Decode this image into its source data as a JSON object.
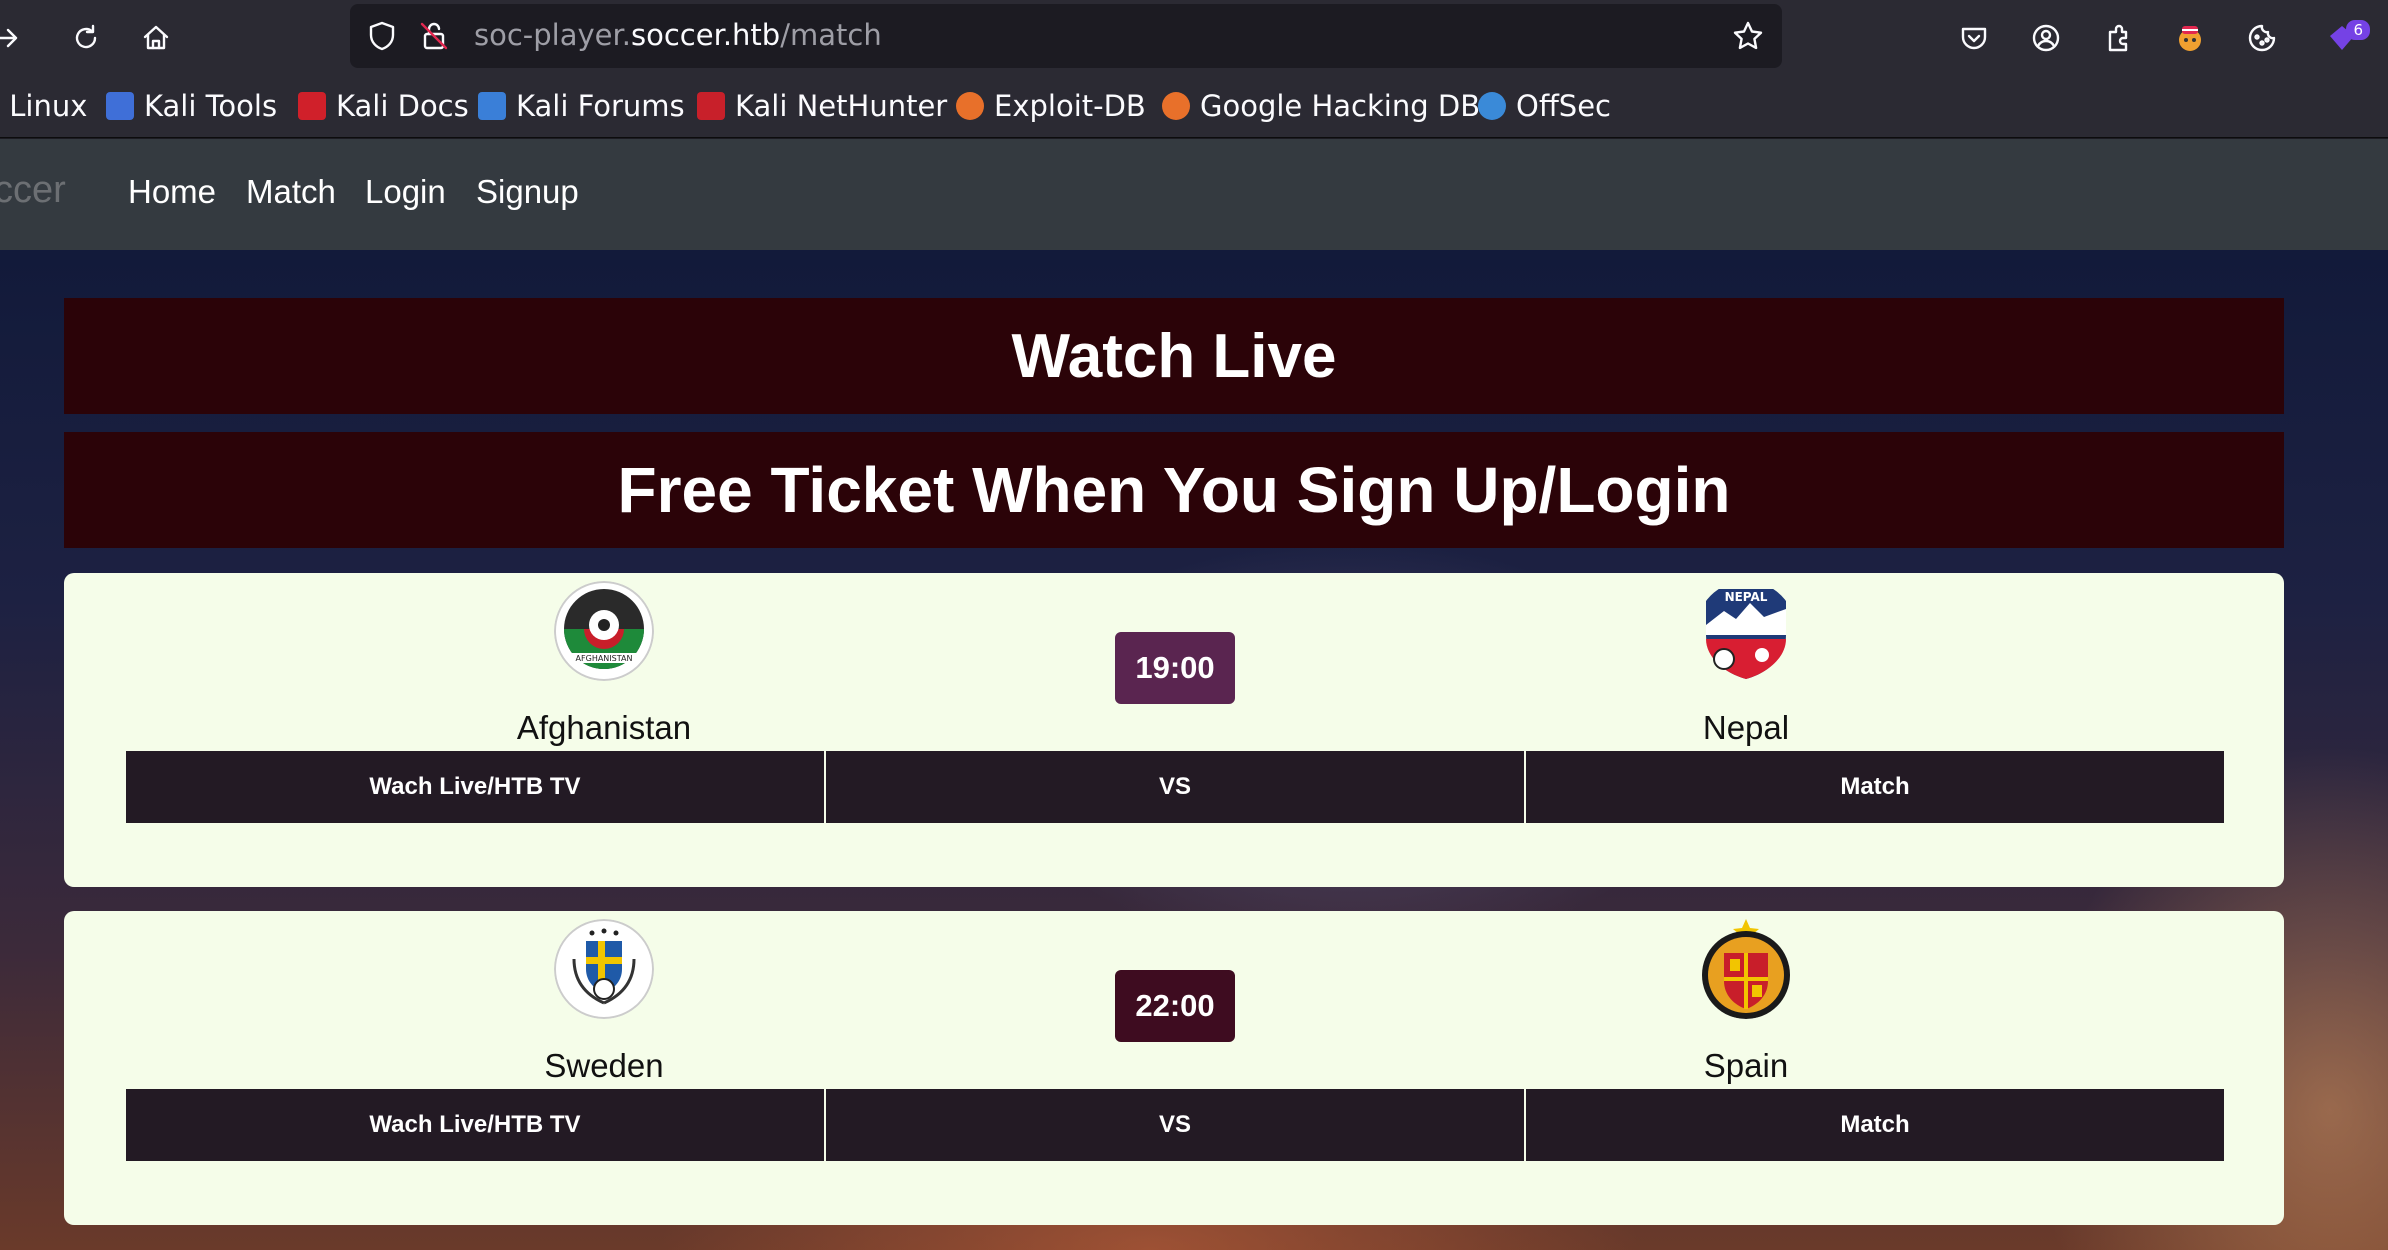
{
  "browser": {
    "url_prefix": "soc-player.",
    "url_domain": "soccer.htb",
    "url_path": "/match",
    "extension_badge": "6",
    "bookmarks": [
      {
        "label": "i Linux",
        "color": ""
      },
      {
        "label": "Kali Tools",
        "color": "#3f6fd8"
      },
      {
        "label": "Kali Docs",
        "color": "#d0202a"
      },
      {
        "label": "Kali Forums",
        "color": "#3a7fd8"
      },
      {
        "label": "Kali NetHunter",
        "color": "#c8202a"
      },
      {
        "label": "Exploit-DB",
        "color": "#e8702a"
      },
      {
        "label": "Google Hacking DB",
        "color": "#e8702a"
      },
      {
        "label": "OffSec",
        "color": "#3a8ad8"
      }
    ]
  },
  "site": {
    "brand": "ccer",
    "nav": [
      "Home",
      "Match",
      "Login",
      "Signup"
    ],
    "banner_primary": "Watch Live",
    "banner_secondary": "Free Ticket When You Sign Up/Login"
  },
  "matches": [
    {
      "home": "Afghanistan",
      "away": "Nepal",
      "time": "19:00",
      "time_color": "#5a2550",
      "actions": [
        "Wach Live/HTB TV",
        "VS",
        "Match"
      ]
    },
    {
      "home": "Sweden",
      "away": "Spain",
      "time": "22:00",
      "time_color": "#3e0c20",
      "actions": [
        "Wach Live/HTB TV",
        "VS",
        "Match"
      ]
    }
  ]
}
